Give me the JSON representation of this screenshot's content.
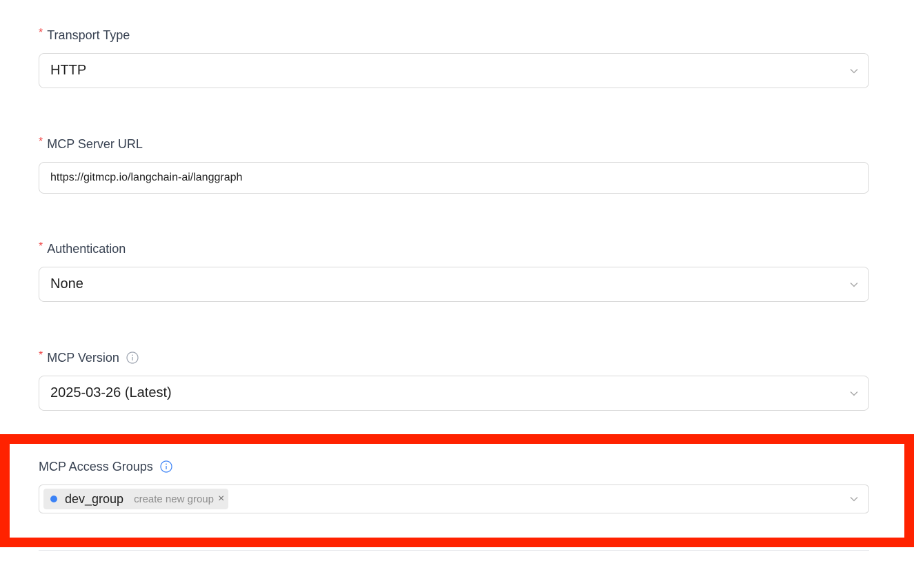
{
  "fields": {
    "transport_type": {
      "label": "Transport Type",
      "required": "*",
      "value": "HTTP"
    },
    "server_url": {
      "label": "MCP Server URL",
      "required": "*",
      "value": "https://gitmcp.io/langchain-ai/langgraph"
    },
    "authentication": {
      "label": "Authentication",
      "required": "*",
      "value": "None"
    },
    "mcp_version": {
      "label": "MCP Version",
      "required": "*",
      "value": "2025-03-26 (Latest)"
    },
    "access_groups": {
      "label": "MCP Access Groups",
      "tags": [
        {
          "label": "dev_group",
          "hint": "create new group",
          "close": "×"
        }
      ]
    }
  },
  "icons": {
    "chevron": "chevron-down-icon",
    "info": "info-icon",
    "close": "close-icon"
  },
  "colors": {
    "required": "#ef4444",
    "info_accent": "#3b82f6",
    "tag_dot": "#3b82f6",
    "highlight_border": "#ff2200",
    "input_border": "#d9d9d9"
  }
}
